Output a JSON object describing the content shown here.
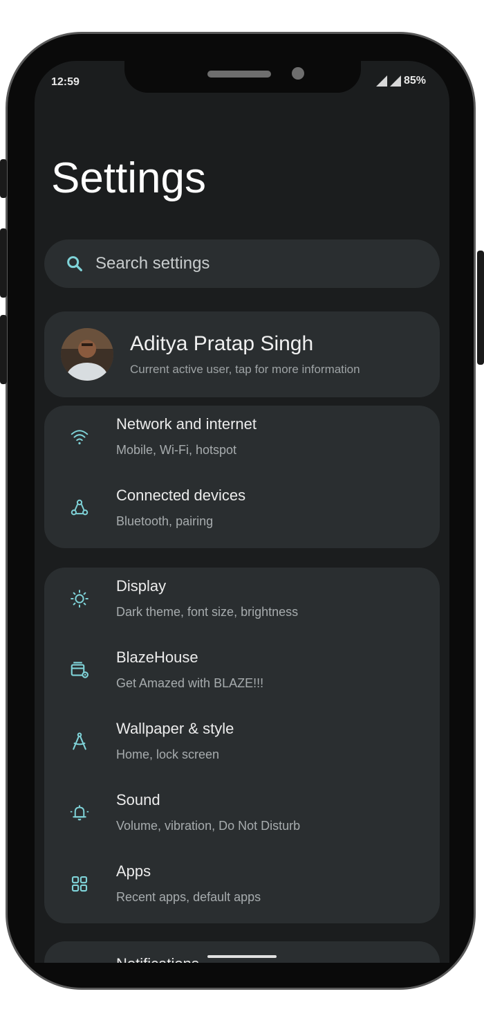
{
  "status_bar": {
    "time": "12:59",
    "battery": "85%"
  },
  "page": {
    "title": "Settings"
  },
  "search": {
    "placeholder": "Search settings"
  },
  "user": {
    "name": "Aditya Pratap Singh",
    "subtitle": "Current active user, tap for more information"
  },
  "groups": [
    {
      "items": [
        {
          "title": "Network and internet",
          "subtitle": "Mobile, Wi-Fi, hotspot",
          "icon": "wifi-icon"
        },
        {
          "title": "Connected devices",
          "subtitle": "Bluetooth, pairing",
          "icon": "connected-devices-icon"
        }
      ]
    },
    {
      "items": [
        {
          "title": "Display",
          "subtitle": "Dark theme, font size, brightness",
          "icon": "brightness-icon"
        },
        {
          "title": "BlazeHouse",
          "subtitle": "Get Amazed with BLAZE!!!",
          "icon": "blazehouse-icon"
        },
        {
          "title": "Wallpaper & style",
          "subtitle": "Home, lock screen",
          "icon": "wallpaper-style-icon"
        },
        {
          "title": "Sound",
          "subtitle": "Volume, vibration, Do Not Disturb",
          "icon": "sound-icon"
        },
        {
          "title": "Apps",
          "subtitle": "Recent apps, default apps",
          "icon": "apps-grid-icon"
        }
      ]
    },
    {
      "items": [
        {
          "title": "Notifications",
          "icon": "notifications-icon"
        }
      ]
    }
  ],
  "colors": {
    "accent": "#7fd3d8",
    "background": "#1b1d1e",
    "card": "#2a2e30"
  }
}
